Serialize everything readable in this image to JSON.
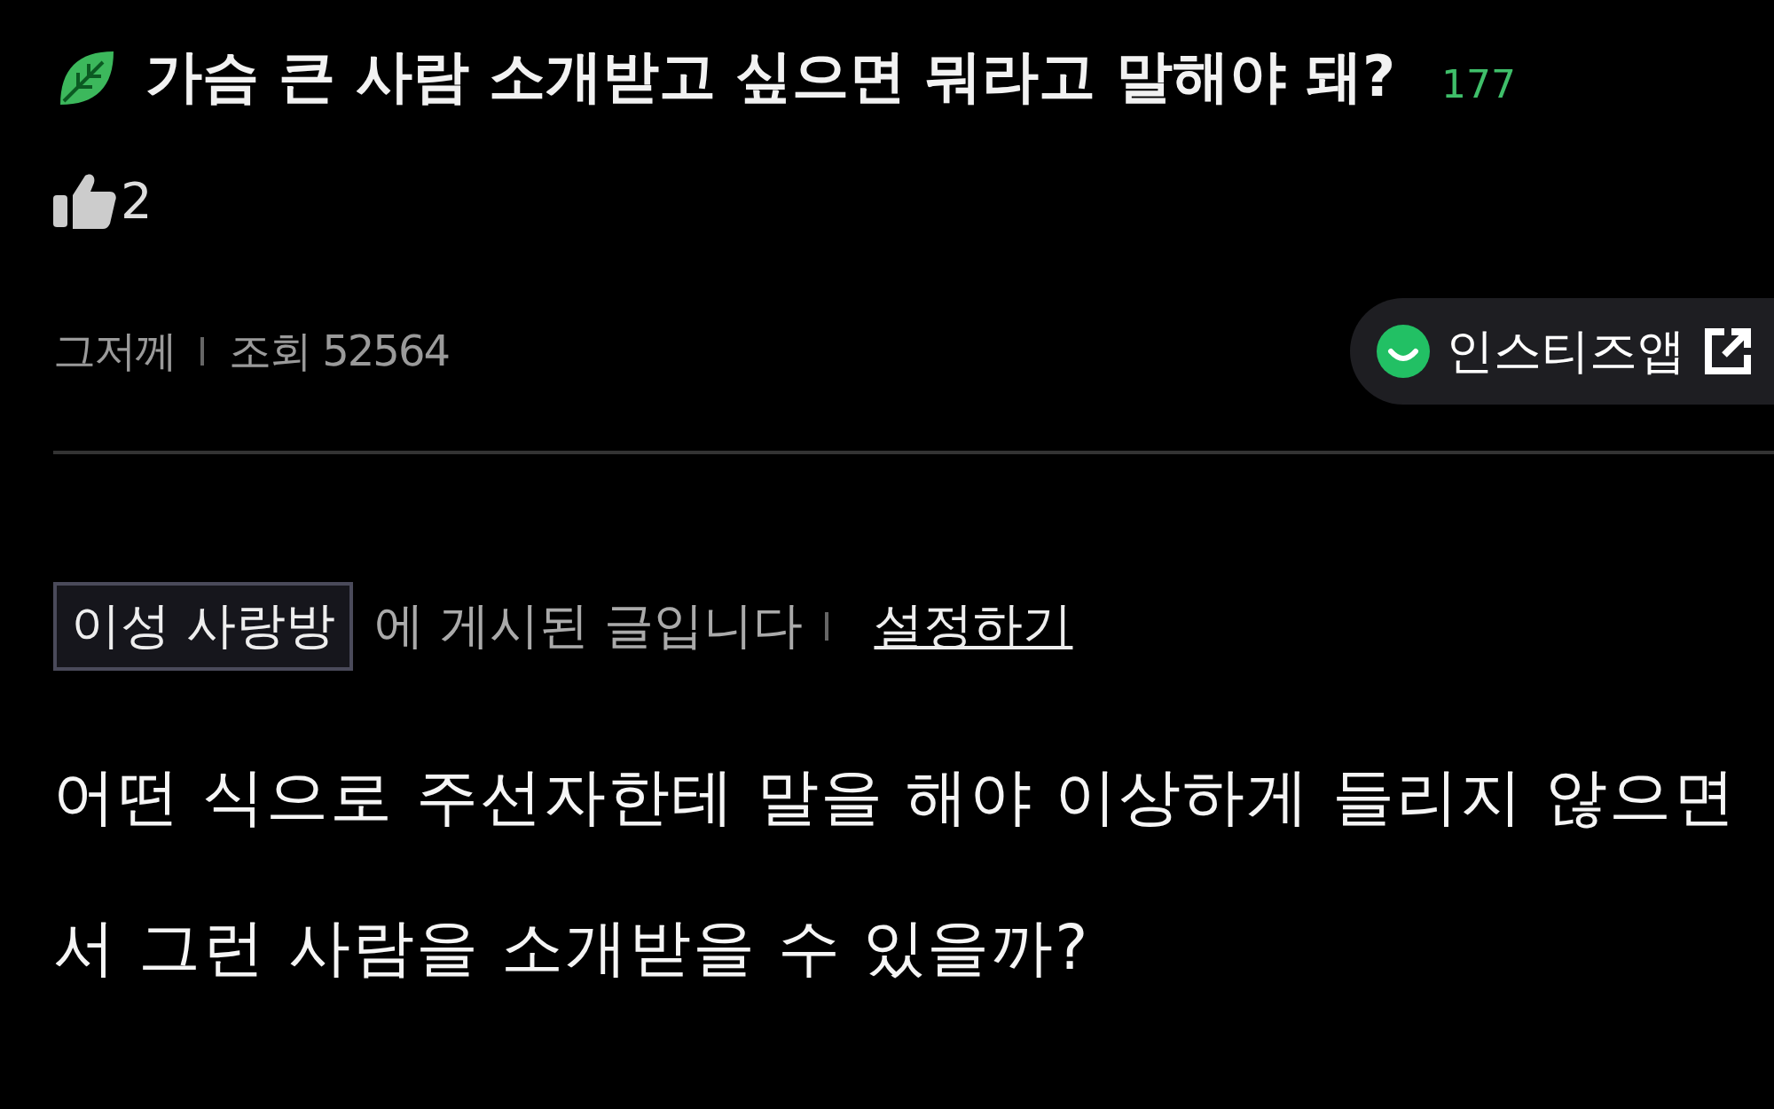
{
  "post": {
    "title": "가슴 큰 사람 소개받고 싶으면 뭐라고 말해야 돼?",
    "comment_count": "177",
    "likes": "2",
    "date": "그저께",
    "views": "조회 52564"
  },
  "app_button": {
    "label": "인스티즈앱"
  },
  "board": {
    "name": "이성 사랑방",
    "notice": "에 게시된 글입니다",
    "settings_link": "설정하기"
  },
  "body": "어떤 식으로 주선자한테 말을 해야 이상하게 들리지 않으면서 그런 사람을 소개받을 수 있을까?"
}
